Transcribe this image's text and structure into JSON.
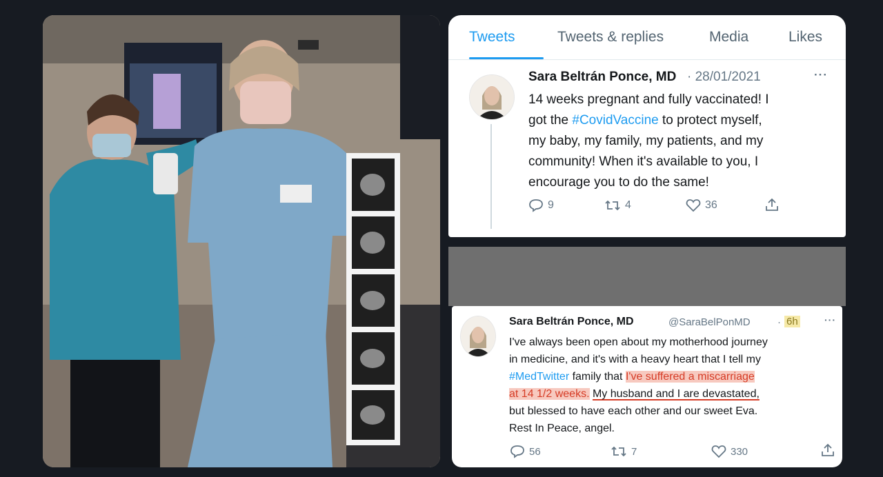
{
  "tabs": [
    {
      "label": "Tweets",
      "active": true
    },
    {
      "label": "Tweets & replies",
      "active": false
    },
    {
      "label": "Media",
      "active": false
    },
    {
      "label": "Likes",
      "active": false
    }
  ],
  "tweet1": {
    "name": "Sara Beltrán Ponce, MD",
    "date": "· 28/01/2021",
    "more": "···",
    "line1": "14 weeks pregnant and fully vaccinated! I",
    "line2_pre": "got the ",
    "line2_tag": "#CovidVaccine",
    "line2_post": " to protect myself,",
    "line3": "my baby, my family, my patients, and my",
    "line4": "community! When it's available to you, I",
    "line5": "encourage you to do the same!",
    "replies": "9",
    "retweets": "4",
    "likes": "36"
  },
  "tweet2": {
    "name": "Sara Beltrán Ponce, MD",
    "handle": "@SaraBelPonMD",
    "sep": "·",
    "time": "6h",
    "more": "···",
    "line1": "I've always been open about my motherhood journey",
    "line2": "in medicine, and it's with a heavy heart that I tell my",
    "line3_tag": "#MedTwitter",
    "line3_mid": " family that ",
    "line3_hl": "I've suffered a miscarriage",
    "line4_hl": "at 14 1/2 weeks.",
    "line4_ul": "My husband and I are devastated,",
    "line5": "but blessed to have each other and our sweet Eva.",
    "line6": "Rest In Peace, angel.",
    "replies": "56",
    "retweets": "7",
    "likes": "330"
  },
  "colors": {
    "accent": "#1d9bf0",
    "highlight": "#f7c9bf",
    "highlight_text": "#d63b25"
  },
  "icons": [
    "reply-icon",
    "retweet-icon",
    "like-icon",
    "share-icon",
    "more-icon"
  ]
}
